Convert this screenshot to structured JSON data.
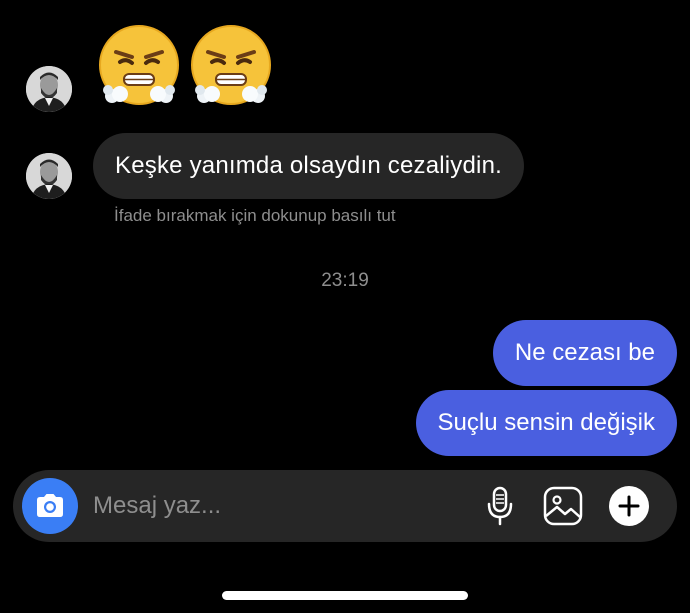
{
  "thread": {
    "emoji_message": "😤😤",
    "incoming_message": "Keşke yanımda olsaydın cezaliydin.",
    "reaction_hint": "İfade bırakmak için dokunup basılı tut",
    "timestamp": "23:19",
    "outgoing_messages": [
      "Ne cezası be",
      "Suçlu sensin değişik"
    ]
  },
  "composer": {
    "placeholder": "Mesaj yaz...",
    "icons": [
      "camera-icon",
      "microphone-icon",
      "gallery-icon",
      "plus-icon"
    ]
  },
  "colors": {
    "background": "#000000",
    "incoming_bubble": "#262626",
    "outgoing_bubble": "#4a5fe0",
    "camera_button": "#3a7ef5",
    "secondary_text": "#8e8e8e"
  }
}
